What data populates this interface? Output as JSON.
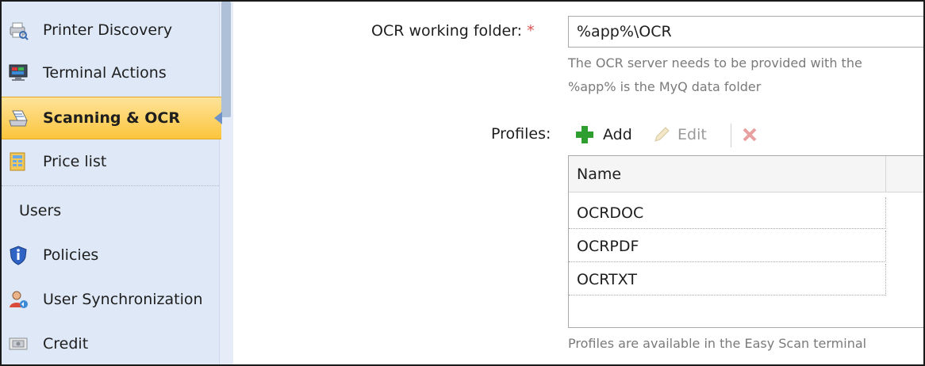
{
  "sidebar": {
    "items": [
      {
        "label": "Printer Discovery",
        "icon": "printer-discovery-icon"
      },
      {
        "label": "Terminal Actions",
        "icon": "terminal-actions-icon"
      },
      {
        "label": "Scanning & OCR",
        "icon": "scanner-icon",
        "active": true
      },
      {
        "label": "Price list",
        "icon": "price-list-icon"
      },
      {
        "label": "Users",
        "icon": "users-icon"
      },
      {
        "label": "Policies",
        "icon": "shield-icon"
      },
      {
        "label": "User Synchronization",
        "icon": "user-sync-icon"
      },
      {
        "label": "Credit",
        "icon": "credit-icon"
      }
    ]
  },
  "form": {
    "ocr_folder_label": "OCR working folder:",
    "required_mark": "*",
    "ocr_folder_value": "%app%\\OCR",
    "ocr_hint_line1": "The OCR server needs to be provided with the",
    "ocr_hint_line2": "%app% is the MyQ data folder",
    "profiles_label": "Profiles:"
  },
  "toolbar": {
    "add_label": "Add",
    "edit_label": "Edit"
  },
  "profiles_grid": {
    "column_header": "Name",
    "rows": [
      "OCRDOC",
      "OCRPDF",
      "OCRTXT"
    ]
  },
  "footer_hint": "Profiles are available in the Easy Scan terminal",
  "colors": {
    "sidebar_bg": "#dfe8f6",
    "active_bg": "#fbc53c",
    "add_green": "#2e9e2e",
    "delete_red": "#e37a7a"
  }
}
